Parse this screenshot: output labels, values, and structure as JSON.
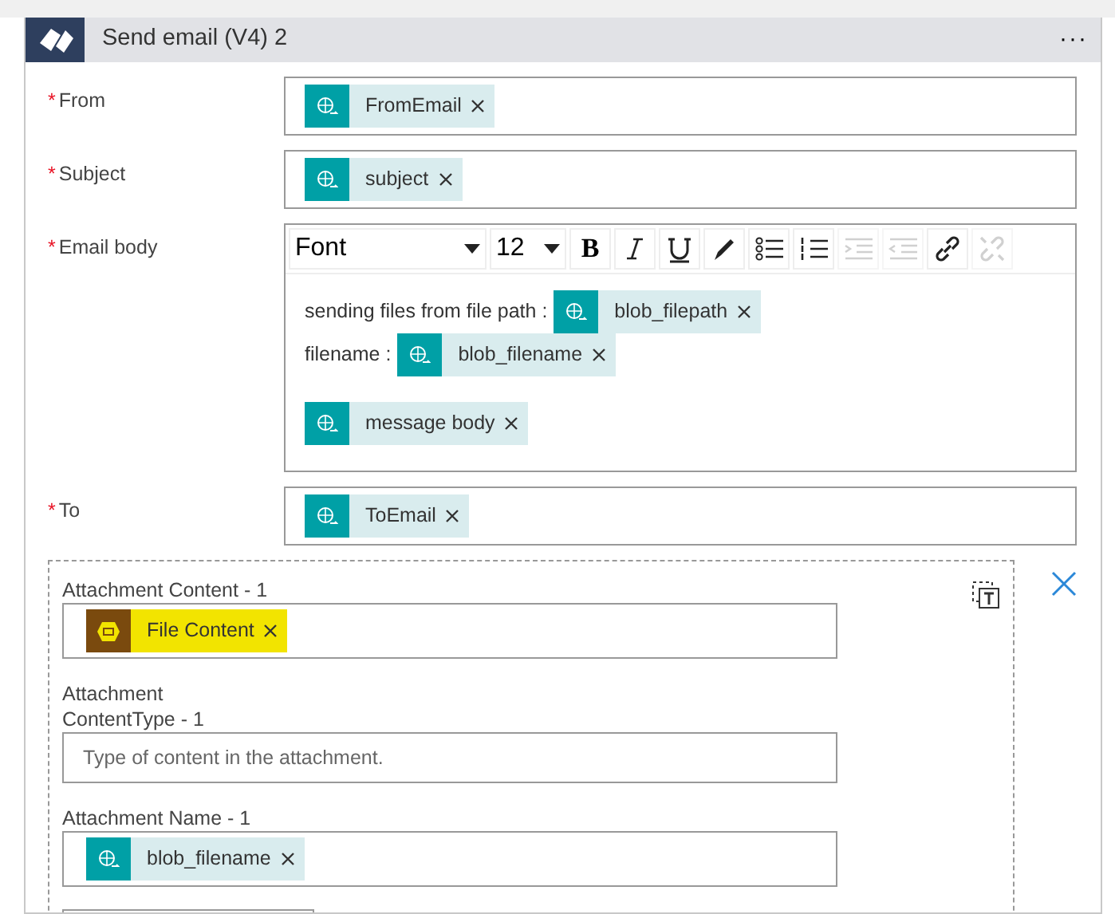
{
  "header": {
    "title": "Send email (V4) 2",
    "menu": "···"
  },
  "fields": [
    {
      "kind": "tokens",
      "label": "From",
      "required": true,
      "required_mark": "*",
      "tokens": [
        {
          "text": "FromEmail",
          "kind": "dynamic"
        }
      ]
    },
    {
      "kind": "tokens",
      "label": "Subject",
      "required": true,
      "required_mark": "*",
      "tokens": [
        {
          "text": "subject",
          "kind": "dynamic"
        }
      ]
    },
    {
      "kind": "editor",
      "label": "Email body",
      "required": true,
      "required_mark": "*",
      "font": "Font",
      "size": "12",
      "tools": [
        {
          "kind": "bold",
          "label": "B",
          "disabled": false
        },
        {
          "kind": "italic",
          "disabled": false
        },
        {
          "kind": "underline",
          "disabled": false
        },
        {
          "kind": "pen",
          "disabled": false
        },
        {
          "kind": "bullets",
          "disabled": false
        },
        {
          "kind": "numbers",
          "disabled": false
        },
        {
          "kind": "indent",
          "disabled": true
        },
        {
          "kind": "outdent",
          "disabled": true
        },
        {
          "kind": "link",
          "disabled": false
        },
        {
          "kind": "unlink",
          "disabled": true
        }
      ],
      "lines": [
        {
          "text": "sending files from file path :",
          "tokens": [
            {
              "text": "blob_filepath",
              "kind": "dynamic"
            }
          ]
        },
        {
          "text": "filename :",
          "tokens": [
            {
              "text": "blob_filename",
              "kind": "dynamic"
            }
          ]
        },
        {
          "tokens": [
            {
              "text": "message body",
              "kind": "dynamic"
            }
          ]
        }
      ]
    },
    {
      "kind": "tokens",
      "label": "To",
      "required": true,
      "required_mark": "*",
      "tokens": [
        {
          "text": "ToEmail",
          "kind": "dynamic"
        }
      ]
    }
  ],
  "attachment": {
    "fields": [
      {
        "label": "Attachment Content - 1",
        "tokens": [
          {
            "text": "File Content",
            "kind": "file",
            "highlighted": true
          }
        ]
      },
      {
        "label": "Attachment\nContentType - 1",
        "placeholder": "Type of content in the attachment."
      },
      {
        "label": "Attachment Name - 1",
        "tokens": [
          {
            "text": "blob_filename",
            "kind": "dynamic",
            "highlighted": false
          }
        ]
      }
    ]
  }
}
